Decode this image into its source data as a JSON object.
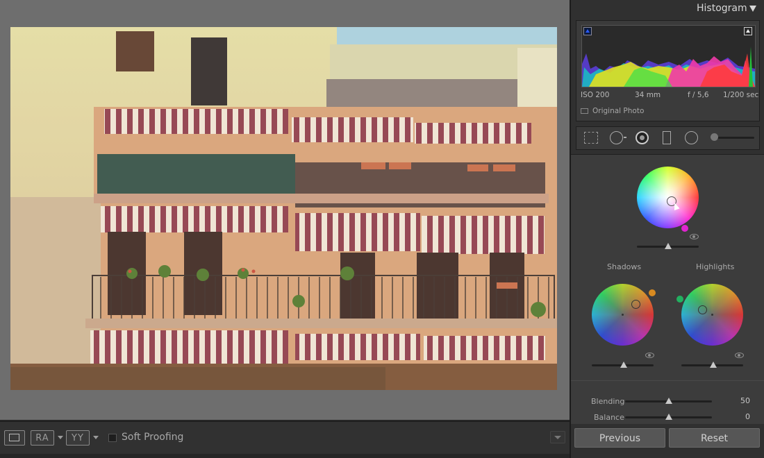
{
  "histogram": {
    "title": "Histogram",
    "iso": "ISO 200",
    "focal": "34 mm",
    "aperture": "f / 5,6",
    "shutter": "1/200 sec",
    "original_photo_label": "Original Photo"
  },
  "color_grading": {
    "shadows_label": "Shadows",
    "highlights_label": "Highlights",
    "blending_label": "Blending",
    "blending_value": "50",
    "balance_label": "Balance",
    "balance_value": "0"
  },
  "toolbar": {
    "ra_label": "RA",
    "yy_label": "YY",
    "soft_proofing_label": "Soft Proofing"
  },
  "buttons": {
    "previous": "Previous",
    "reset": "Reset"
  }
}
